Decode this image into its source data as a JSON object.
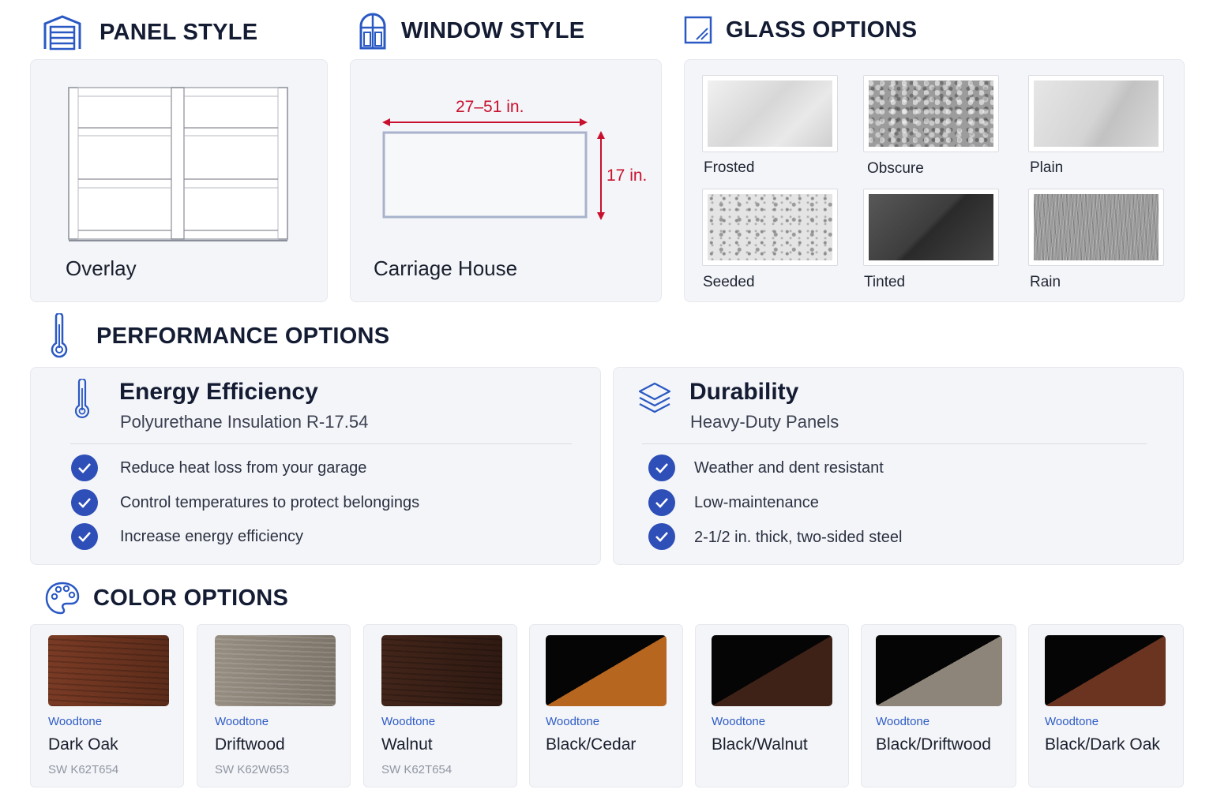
{
  "panel_style": {
    "title": "PANEL STYLE",
    "label": "Overlay"
  },
  "window_style": {
    "title": "WINDOW STYLE",
    "label": "Carriage House",
    "width_dim": "27–51 in.",
    "height_dim": "17 in."
  },
  "glass_options": {
    "title": "GLASS OPTIONS",
    "items": [
      {
        "label": "Frosted"
      },
      {
        "label": "Obscure"
      },
      {
        "label": "Plain"
      },
      {
        "label": "Seeded"
      },
      {
        "label": "Tinted"
      },
      {
        "label": "Rain"
      }
    ]
  },
  "performance": {
    "title": "PERFORMANCE OPTIONS",
    "energy": {
      "title": "Energy Efficiency",
      "subtitle": "Polyurethane Insulation R-17.54",
      "bullets": [
        "Reduce heat loss from your garage",
        "Control temperatures to protect belongings",
        "Increase energy efficiency"
      ]
    },
    "durability": {
      "title": "Durability",
      "subtitle": "Heavy-Duty Panels",
      "bullets": [
        "Weather and dent resistant",
        "Low-maintenance",
        "2-1/2 in. thick, two-sided steel"
      ]
    }
  },
  "colors": {
    "title": "COLOR OPTIONS",
    "items": [
      {
        "type": "Woodtone",
        "name": "Dark Oak",
        "code": "SW K62T654"
      },
      {
        "type": "Woodtone",
        "name": "Driftwood",
        "code": "SW K62W653"
      },
      {
        "type": "Woodtone",
        "name": "Walnut",
        "code": "SW K62T654"
      },
      {
        "type": "Woodtone",
        "name": "Black/Cedar",
        "code": ""
      },
      {
        "type": "Woodtone",
        "name": "Black/Walnut",
        "code": ""
      },
      {
        "type": "Woodtone",
        "name": "Black/Driftwood",
        "code": ""
      },
      {
        "type": "Woodtone",
        "name": "Black/Dark Oak",
        "code": ""
      }
    ]
  },
  "accent_color": "#2e4fb8",
  "dimension_color": "#c8102e"
}
